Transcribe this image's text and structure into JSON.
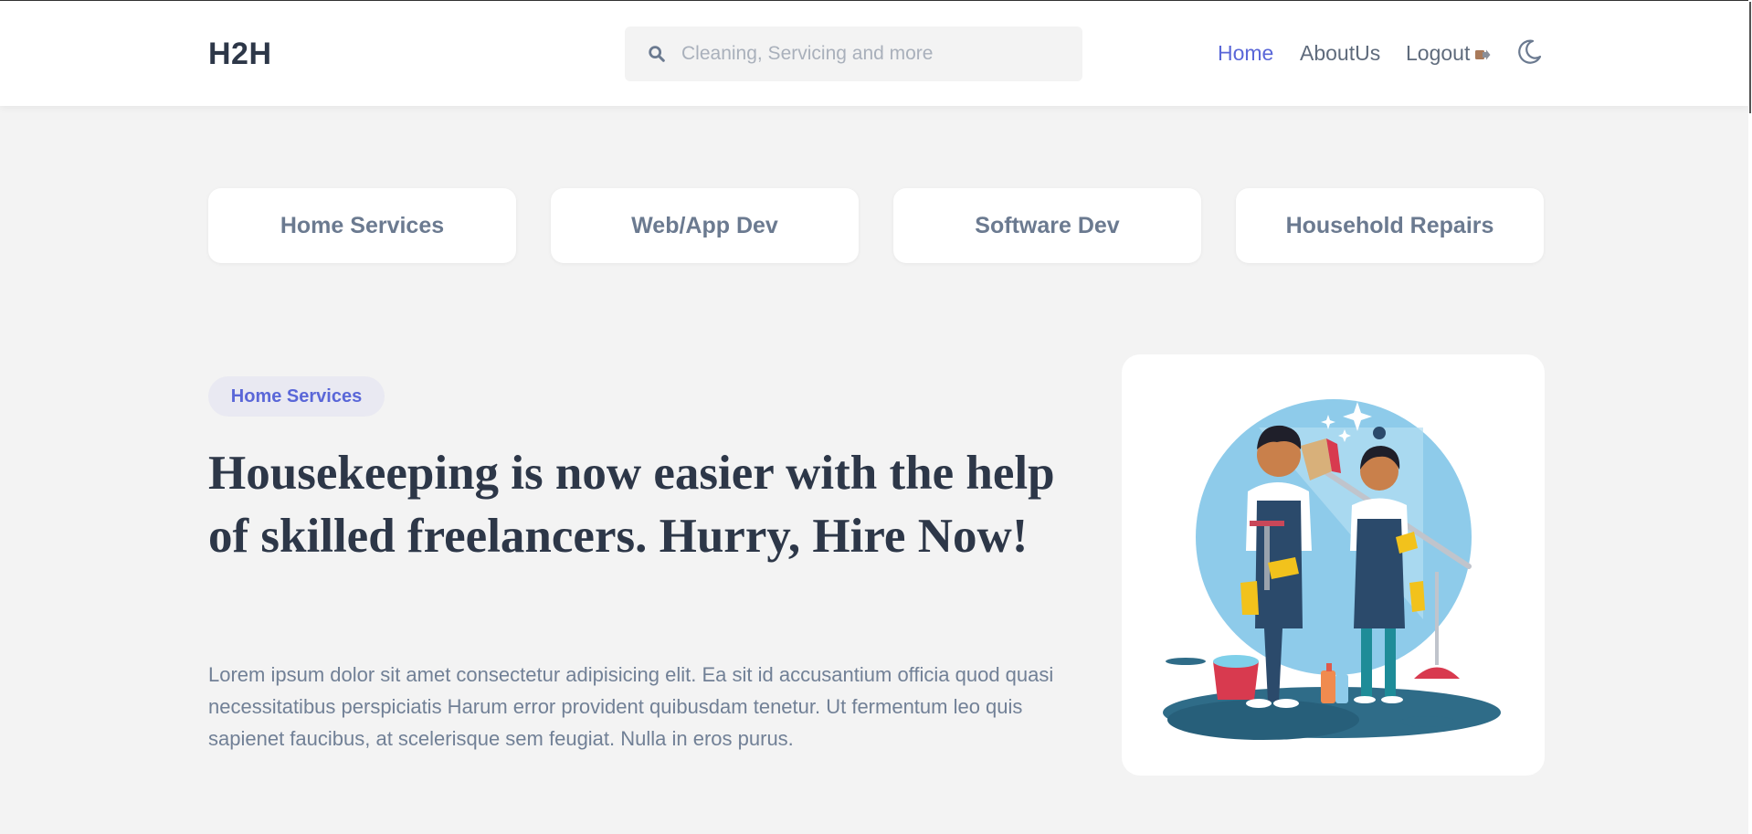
{
  "brand": {
    "logo": "H2H"
  },
  "search": {
    "placeholder": "Cleaning, Servicing and more",
    "value": ""
  },
  "nav": {
    "home": "Home",
    "about": "AboutUs",
    "logout": "Logout",
    "active": "Home"
  },
  "categories": [
    {
      "label": "Home Services"
    },
    {
      "label": "Web/App Dev"
    },
    {
      "label": "Software Dev"
    },
    {
      "label": "Household Repairs"
    }
  ],
  "hero": {
    "badge": "Home Services",
    "headline": "Housekeeping is now easier with the help of skilled freelancers. Hurry, Hire Now!",
    "paragraph": "Lorem ipsum dolor sit amet consectetur adipisicing elit. Ea sit id accusantium officia quod quasi necessitatibus perspiciatis Harum error provident quibusdam tenetur. Ut fermentum leo quis sapienet faucibus, at scelerisque sem feugiat. Nulla in eros purus."
  },
  "icons": {
    "search": "search-icon",
    "logout": "logout-icon",
    "theme": "moon-icon"
  },
  "colors": {
    "accent": "#5a67d8",
    "text": "#2d3748",
    "muted": "#718096",
    "background": "#f3f3f3"
  }
}
